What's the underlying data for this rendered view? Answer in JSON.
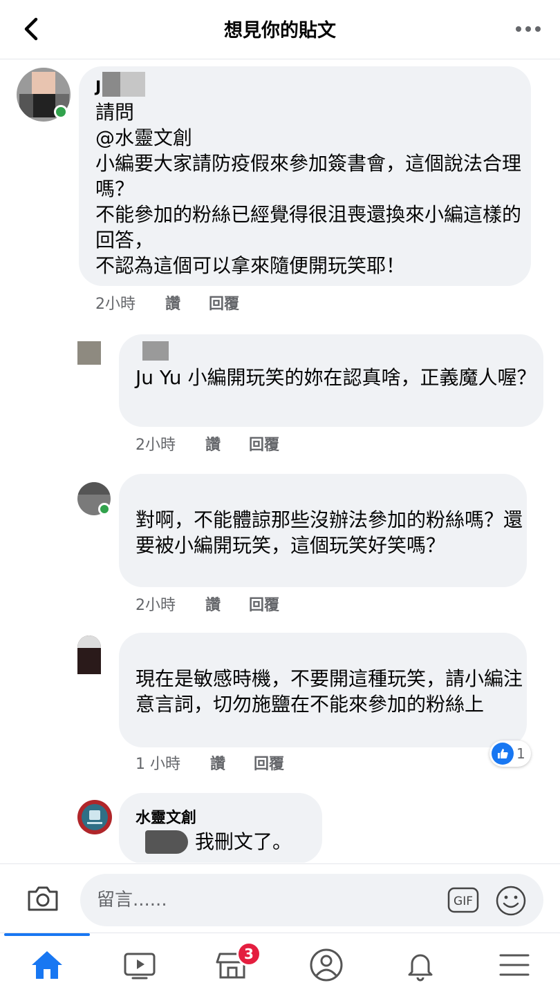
{
  "header": {
    "title": "想見你的貼文",
    "back_icon": "chevron-left-icon",
    "more_icon": "more-horizontal-icon"
  },
  "comments": [
    {
      "author": "J",
      "text": "請問\n@水靈文創\n小編要大家請防疫假來參加簽書會，這個說法合理嗎？\n不能參加的粉絲已經覺得很沮喪還換來小編這樣的回答，\n不認為這個可以拿來隨便開玩笑耶！",
      "time": "2小時",
      "like": "讚",
      "reply": "回覆"
    },
    {
      "author": "",
      "text": "Ju Yu 小編開玩笑的妳在認真啥，正義魔人喔？",
      "time": "2小時",
      "like": "讚",
      "reply": "回覆"
    },
    {
      "author": "",
      "text": "對啊，不能體諒那些沒辦法參加的粉絲嗎？還要被小編開玩笑，這個玩笑好笑嗎？",
      "time": "2小時",
      "like": "讚",
      "reply": "回覆"
    },
    {
      "author": "",
      "text": "現在是敏感時機，不要開這種玩笑，請小編注意言詞，切勿施鹽在不能來參加的粉絲上",
      "time": "1 小時",
      "like": "讚",
      "reply": "回覆",
      "reaction_count": "1"
    },
    {
      "author": "水靈文創",
      "text": "我刪文了。"
    }
  ],
  "composer": {
    "placeholder": "留言......",
    "camera_icon": "camera-icon",
    "gif_label": "GIF",
    "emoji_icon": "emoji-icon"
  },
  "nav": {
    "items": [
      "home-icon",
      "video-icon",
      "marketplace-icon",
      "profile-icon",
      "bell-icon",
      "menu-icon"
    ],
    "marketplace_badge": "3"
  },
  "colors": {
    "accent": "#1877f2",
    "bubble": "#f0f2f5",
    "online": "#31a24c",
    "badge": "#e41e3f"
  }
}
